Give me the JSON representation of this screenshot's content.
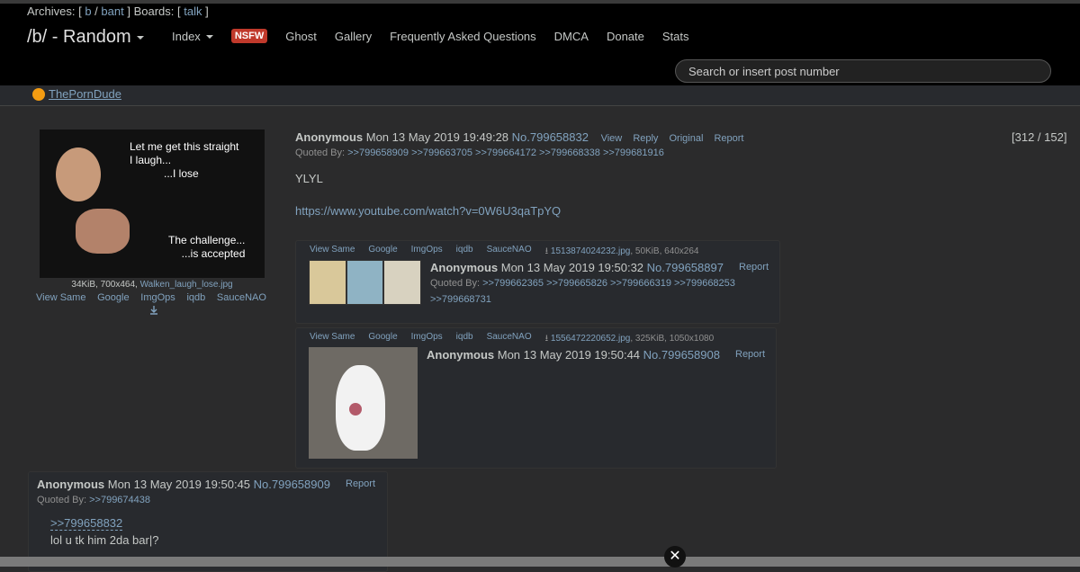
{
  "header": {
    "archives": {
      "prefix": "Archives: [",
      "b": "b",
      "sep": "/",
      "bant": "bant",
      "boards_text": "] Boards: [",
      "talk": "talk",
      "close": "]"
    },
    "board_title": "/b/ - Random",
    "nav": {
      "index": "Index",
      "nsfw": "NSFW",
      "ghost": "Ghost",
      "gallery": "Gallery",
      "faq": "Frequently Asked Questions",
      "dmca": "DMCA",
      "donate": "Donate",
      "stats": "Stats"
    },
    "search_placeholder": "Search or insert post number",
    "ad_link": "ThePornDude"
  },
  "op": {
    "thumb_text_top": [
      "Let me get this straight",
      "I laugh...",
      "...I lose"
    ],
    "thumb_text_bottom": [
      "The challenge...",
      "...is accepted"
    ],
    "file_meta": "34KiB, 700x464,",
    "filename": "Walken_laugh_lose.jpg",
    "image_links": [
      "View Same",
      "Google",
      "ImgOps",
      "iqdb",
      "SauceNAO"
    ],
    "name": "Anonymous",
    "date": "Mon 13 May 2019 19:49:28",
    "number": "No.799658832",
    "actions": [
      "View",
      "Reply",
      "Original",
      "Report"
    ],
    "quoted_label": "Quoted By:",
    "quoted_by": ">>799658909 >>799663705 >>799664172 >>799668338 >>799681916",
    "counter": "[312 / 152]",
    "text": "YLYL",
    "url": "https://www.youtube.com/watch?v=0W6U3qaTpYQ"
  },
  "replies": [
    {
      "image_links": [
        "View Same",
        "Google",
        "ImgOps",
        "iqdb",
        "SauceNAO"
      ],
      "filename": "1513874024232.jpg",
      "file_meta": ", 50KiB, 640x264",
      "name": "Anonymous",
      "date": "Mon 13 May 2019 19:50:32",
      "number": "No.799658897",
      "report": "Report",
      "quoted_label": "Quoted By:",
      "quoted_by_1": ">>799662365 >>799665826 >>799666319 >>799668253",
      "quoted_by_2": ">>799668731"
    },
    {
      "image_links": [
        "View Same",
        "Google",
        "ImgOps",
        "iqdb",
        "SauceNAO"
      ],
      "filename": "1556472220652.jpg",
      "file_meta": ", 325KiB, 1050x1080",
      "name": "Anonymous",
      "date": "Mon 13 May 2019 19:50:44",
      "number": "No.799658908",
      "report": "Report"
    },
    {
      "name": "Anonymous",
      "date": "Mon 13 May 2019 19:50:45",
      "number": "No.799658909",
      "report": "Report",
      "quoted_label": "Quoted By:",
      "quoted_by": ">>799674438",
      "quote_link": ">>799658832",
      "text": "lol u tk him 2da bar|?"
    }
  ],
  "close_glyph": "✕"
}
